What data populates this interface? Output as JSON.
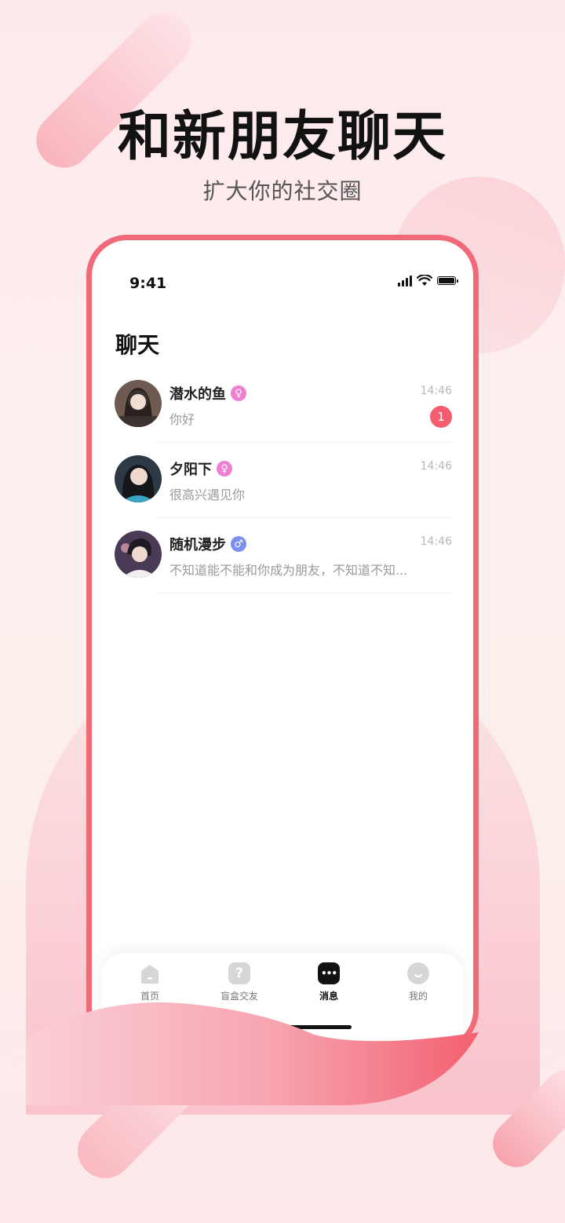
{
  "promo": {
    "headline": "和新朋友聊天",
    "subline": "扩大你的社交圈"
  },
  "status_bar": {
    "time": "9:41"
  },
  "chat_screen": {
    "title": "聊天",
    "conversations": [
      {
        "name": "潜水的鱼",
        "gender": "female",
        "gender_symbol": "♀",
        "time": "14:46",
        "preview": "你好",
        "unread": "1"
      },
      {
        "name": "夕阳下",
        "gender": "female",
        "gender_symbol": "♀",
        "time": "14:46",
        "preview": "很高兴遇见你"
      },
      {
        "name": "随机漫步",
        "gender": "male",
        "gender_symbol": "♂",
        "time": "14:46",
        "preview": "不知道能不能和你成为朋友，不知道不知..."
      }
    ]
  },
  "tabbar": {
    "home": "首页",
    "blind_box": "盲盒交友",
    "blind_box_icon_glyph": "?",
    "messages": "消息",
    "messages_icon_glyph": "•••",
    "mine": "我的",
    "active_tab": "messages"
  },
  "colors": {
    "accent": "#f06a7a",
    "badge": "#f55c6e",
    "female": "#ef7fd0",
    "male": "#7b8ff0"
  }
}
